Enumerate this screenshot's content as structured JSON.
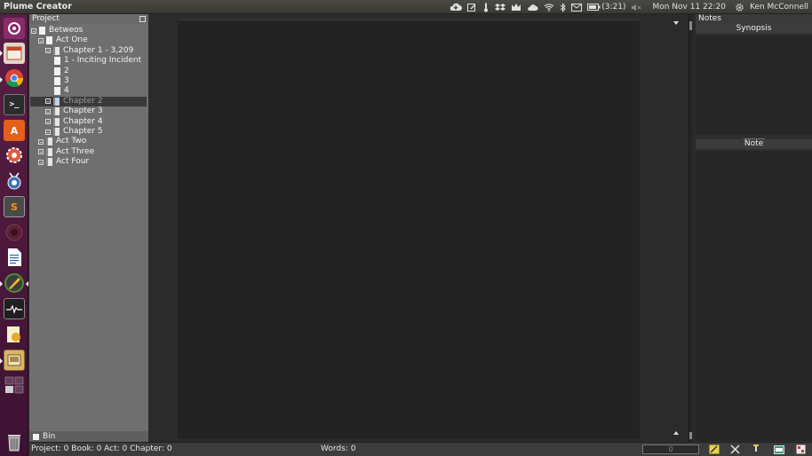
{
  "top_panel": {
    "app_title": "Plume Creator",
    "battery_time": "(3:21)",
    "datetime": "Mon Nov 11  22:20",
    "user": "Ken McConnell",
    "icons": [
      "cloud-download-icon",
      "edit-icon",
      "thermometer-icon",
      "dropbox-icon",
      "crown-icon",
      "cloud-icon",
      "wifi-icon",
      "bluetooth-icon",
      "mail-icon",
      "battery-icon",
      "volume-icon",
      "gear-icon"
    ]
  },
  "launcher": {
    "items": [
      {
        "name": "dash-icon",
        "color": "#8a2b6b"
      },
      {
        "name": "files-icon",
        "color": "#c04a2a"
      },
      {
        "name": "chrome-icon",
        "color": "#2e7d32"
      },
      {
        "name": "terminal-icon",
        "color": "#333333"
      },
      {
        "name": "software-center-icon",
        "color": "#e2601b"
      },
      {
        "name": "settings-icon",
        "color": "#b54a4a"
      },
      {
        "name": "bug-icon",
        "color": "#6b6fb0"
      },
      {
        "name": "sublime-icon",
        "color": "#5a5a5a"
      },
      {
        "name": "record-icon",
        "color": "#5a2a3a"
      },
      {
        "name": "document-icon",
        "color": "#2a64b4"
      },
      {
        "name": "plume-icon",
        "color": "#4d8c3a"
      },
      {
        "name": "system-monitor-icon",
        "color": "#2d2d2d"
      },
      {
        "name": "notes-app-icon",
        "color": "#d9a62a"
      },
      {
        "name": "scanner-icon",
        "color": "#c69c48"
      },
      {
        "name": "workspaces-icon",
        "color": "#5b2a4e"
      },
      {
        "name": "trash-icon",
        "color": "#6a6a6a"
      }
    ]
  },
  "project": {
    "header": "Project",
    "tree": [
      {
        "label": "Betweos",
        "depth": 0,
        "icon": "book"
      },
      {
        "label": "Act One",
        "depth": 1,
        "icon": "doc"
      },
      {
        "label": "Chapter 1 - 3,209",
        "depth": 2,
        "icon": "chapter"
      },
      {
        "label": "1 - Inciting Incident",
        "depth": 3,
        "icon": "doc"
      },
      {
        "label": "2",
        "depth": 3,
        "icon": "doc"
      },
      {
        "label": "3",
        "depth": 3,
        "icon": "doc"
      },
      {
        "label": "4",
        "depth": 3,
        "icon": "doc"
      },
      {
        "label": "Chapter 2",
        "depth": 2,
        "icon": "chapter",
        "selected": true
      },
      {
        "label": "Chapter 3",
        "depth": 2,
        "icon": "chapter"
      },
      {
        "label": "Chapter 4",
        "depth": 2,
        "icon": "chapter"
      },
      {
        "label": "Chapter 5",
        "depth": 2,
        "icon": "chapter"
      },
      {
        "label": "Act Two",
        "depth": 1,
        "icon": "chapter"
      },
      {
        "label": "Act Three",
        "depth": 1,
        "icon": "chapter"
      },
      {
        "label": "Act Four",
        "depth": 1,
        "icon": "chapter"
      }
    ],
    "bin": "Bin"
  },
  "notes": {
    "header": "Notes",
    "synopsis": "Synopsis",
    "note": "Note"
  },
  "status": {
    "counts": "Project: 0  Book: 0  Act: 0  Chapter: 0",
    "words": "Words: 0",
    "timer_value": "0"
  }
}
